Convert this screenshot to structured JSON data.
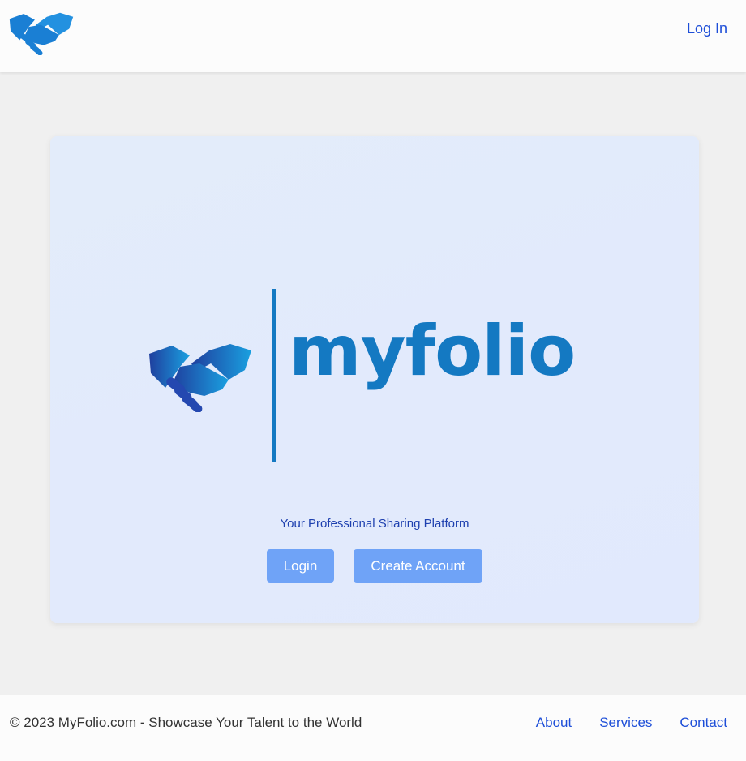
{
  "header": {
    "logo_icon": "handshake-icon",
    "login_link": "Log In"
  },
  "hero": {
    "brand_icon": "handshake-icon",
    "brand_word": "myfolio",
    "tagline": "Your Professional Sharing Platform",
    "login_button": "Login",
    "create_account_button": "Create Account"
  },
  "footer": {
    "copyright": "© 2023 MyFolio.com - Showcase Your Talent to the World",
    "links": [
      "About",
      "Services",
      "Contact"
    ]
  },
  "colors": {
    "brand_blue": "#1479c2",
    "link_blue": "#1d4ed8",
    "button_blue": "#6fa3f7",
    "page_background": "#f0f0f0"
  }
}
